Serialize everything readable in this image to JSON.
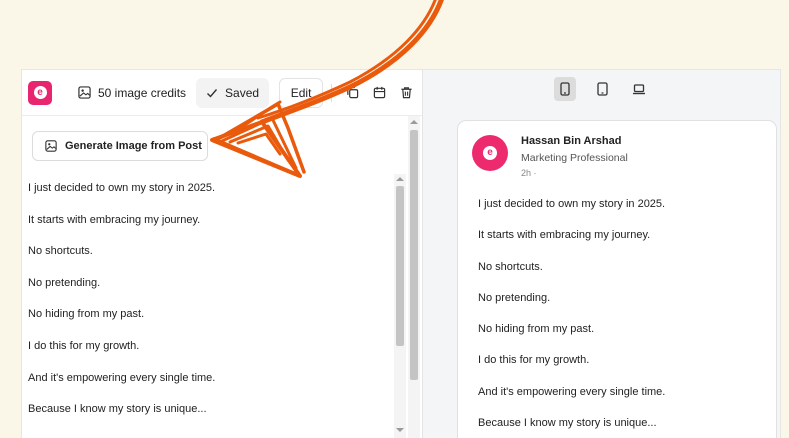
{
  "toolbar": {
    "credits_label": "50 image credits",
    "saved_label": "Saved",
    "edit_label": "Edit",
    "logo_letter": "e"
  },
  "editor": {
    "generate_button_label": "Generate Image from Post",
    "lines": [
      "I just decided to own my story in 2025.",
      "It starts with embracing my journey.",
      "No shortcuts.",
      "No pretending.",
      "No hiding from my past.",
      "I do this for my growth.",
      "And it's empowering every single time.",
      "Because I know my story is unique..."
    ]
  },
  "preview": {
    "author_name": "Hassan Bin Arshad",
    "headline": "Marketing Professional",
    "time": "2h ·",
    "avatar_letter": "e",
    "lines": [
      "I just decided to own my story in 2025.",
      "It starts with embracing my journey.",
      "No shortcuts.",
      "No pretending.",
      "No hiding from my past.",
      "I do this for my growth.",
      "And it's empowering every single time.",
      "Because I know my story is unique..."
    ]
  },
  "colors": {
    "brand_pink": "#e8266f",
    "arrow_orange": "#ea5a0c",
    "page_background": "#fbf7e8"
  }
}
